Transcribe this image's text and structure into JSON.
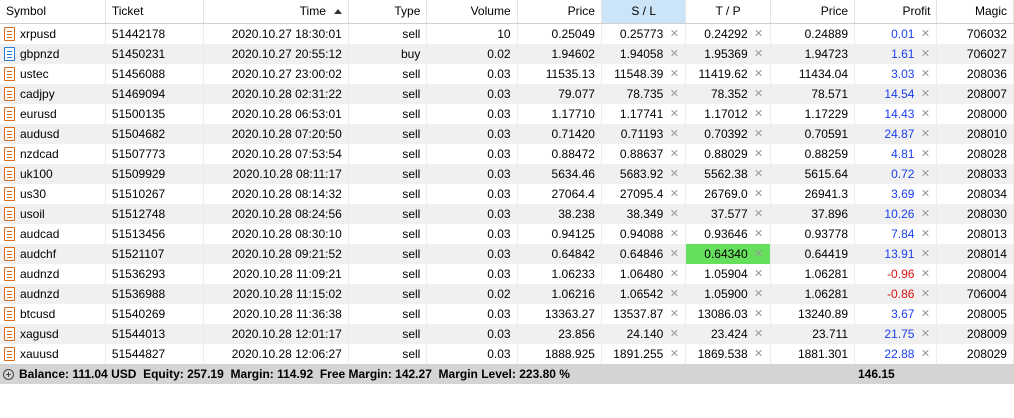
{
  "columns": {
    "symbol": "Symbol",
    "ticket": "Ticket",
    "time": "Time",
    "type": "Type",
    "volume": "Volume",
    "price": "Price",
    "sl": "S / L",
    "tp": "T / P",
    "current_price": "Price",
    "profit": "Profit",
    "magic": "Magic"
  },
  "rows": [
    {
      "symbol": "xrpusd",
      "ticket": "51442178",
      "time": "2020.10.27 18:30:01",
      "type": "sell",
      "volume": "10",
      "price": "0.25049",
      "sl": "0.25773",
      "tp": "0.24292",
      "current": "0.24889",
      "profit": "0.01",
      "magic": "706032",
      "profit_sign": "pos",
      "icon": "sell"
    },
    {
      "symbol": "gbpnzd",
      "ticket": "51450231",
      "time": "2020.10.27 20:55:12",
      "type": "buy",
      "volume": "0.02",
      "price": "1.94602",
      "sl": "1.94058",
      "tp": "1.95369",
      "current": "1.94723",
      "profit": "1.61",
      "magic": "706027",
      "profit_sign": "pos",
      "icon": "buy"
    },
    {
      "symbol": "ustec",
      "ticket": "51456088",
      "time": "2020.10.27 23:00:02",
      "type": "sell",
      "volume": "0.03",
      "price": "11535.13",
      "sl": "11548.39",
      "tp": "11419.62",
      "current": "11434.04",
      "profit": "3.03",
      "magic": "208036",
      "profit_sign": "pos",
      "icon": "sell"
    },
    {
      "symbol": "cadjpy",
      "ticket": "51469094",
      "time": "2020.10.28 02:31:22",
      "type": "sell",
      "volume": "0.03",
      "price": "79.077",
      "sl": "78.735",
      "tp": "78.352",
      "current": "78.571",
      "profit": "14.54",
      "magic": "208007",
      "profit_sign": "pos",
      "icon": "sell"
    },
    {
      "symbol": "eurusd",
      "ticket": "51500135",
      "time": "2020.10.28 06:53:01",
      "type": "sell",
      "volume": "0.03",
      "price": "1.17710",
      "sl": "1.17741",
      "tp": "1.17012",
      "current": "1.17229",
      "profit": "14.43",
      "magic": "208000",
      "profit_sign": "pos",
      "icon": "sell"
    },
    {
      "symbol": "audusd",
      "ticket": "51504682",
      "time": "2020.10.28 07:20:50",
      "type": "sell",
      "volume": "0.03",
      "price": "0.71420",
      "sl": "0.71193",
      "tp": "0.70392",
      "current": "0.70591",
      "profit": "24.87",
      "magic": "208010",
      "profit_sign": "pos",
      "icon": "sell"
    },
    {
      "symbol": "nzdcad",
      "ticket": "51507773",
      "time": "2020.10.28 07:53:54",
      "type": "sell",
      "volume": "0.03",
      "price": "0.88472",
      "sl": "0.88637",
      "tp": "0.88029",
      "current": "0.88259",
      "profit": "4.81",
      "magic": "208028",
      "profit_sign": "pos",
      "icon": "sell"
    },
    {
      "symbol": "uk100",
      "ticket": "51509929",
      "time": "2020.10.28 08:11:17",
      "type": "sell",
      "volume": "0.03",
      "price": "5634.46",
      "sl": "5683.92",
      "tp": "5562.38",
      "current": "5615.64",
      "profit": "0.72",
      "magic": "208033",
      "profit_sign": "pos",
      "icon": "sell"
    },
    {
      "symbol": "us30",
      "ticket": "51510267",
      "time": "2020.10.28 08:14:32",
      "type": "sell",
      "volume": "0.03",
      "price": "27064.4",
      "sl": "27095.4",
      "tp": "26769.0",
      "current": "26941.3",
      "profit": "3.69",
      "magic": "208034",
      "profit_sign": "pos",
      "icon": "sell"
    },
    {
      "symbol": "usoil",
      "ticket": "51512748",
      "time": "2020.10.28 08:24:56",
      "type": "sell",
      "volume": "0.03",
      "price": "38.238",
      "sl": "38.349",
      "tp": "37.577",
      "current": "37.896",
      "profit": "10.26",
      "magic": "208030",
      "profit_sign": "pos",
      "icon": "sell"
    },
    {
      "symbol": "audcad",
      "ticket": "51513456",
      "time": "2020.10.28 08:30:10",
      "type": "sell",
      "volume": "0.03",
      "price": "0.94125",
      "sl": "0.94088",
      "tp": "0.93646",
      "current": "0.93778",
      "profit": "7.84",
      "magic": "208013",
      "profit_sign": "pos",
      "icon": "sell"
    },
    {
      "symbol": "audchf",
      "ticket": "51521107",
      "time": "2020.10.28 09:21:52",
      "type": "sell",
      "volume": "0.03",
      "price": "0.64842",
      "sl": "0.64846",
      "tp": "0.64340",
      "current": "0.64419",
      "profit": "13.91",
      "magic": "208014",
      "profit_sign": "pos",
      "icon": "sell",
      "tp_highlight": true
    },
    {
      "symbol": "audnzd",
      "ticket": "51536293",
      "time": "2020.10.28 11:09:21",
      "type": "sell",
      "volume": "0.03",
      "price": "1.06233",
      "sl": "1.06480",
      "tp": "1.05904",
      "current": "1.06281",
      "profit": "-0.96",
      "magic": "208004",
      "profit_sign": "neg",
      "icon": "sell"
    },
    {
      "symbol": "audnzd",
      "ticket": "51536988",
      "time": "2020.10.28 11:15:02",
      "type": "sell",
      "volume": "0.02",
      "price": "1.06216",
      "sl": "1.06542",
      "tp": "1.05900",
      "current": "1.06281",
      "profit": "-0.86",
      "magic": "706004",
      "profit_sign": "neg",
      "icon": "sell"
    },
    {
      "symbol": "btcusd",
      "ticket": "51540269",
      "time": "2020.10.28 11:36:38",
      "type": "sell",
      "volume": "0.03",
      "price": "13363.27",
      "sl": "13537.87",
      "tp": "13086.03",
      "current": "13240.89",
      "profit": "3.67",
      "magic": "208005",
      "profit_sign": "pos",
      "icon": "sell"
    },
    {
      "symbol": "xagusd",
      "ticket": "51544013",
      "time": "2020.10.28 12:01:17",
      "type": "sell",
      "volume": "0.03",
      "price": "23.856",
      "sl": "24.140",
      "tp": "23.424",
      "current": "23.711",
      "profit": "21.75",
      "magic": "208009",
      "profit_sign": "pos",
      "icon": "sell"
    },
    {
      "symbol": "xauusd",
      "ticket": "51544827",
      "time": "2020.10.28 12:06:27",
      "type": "sell",
      "volume": "0.03",
      "price": "1888.925",
      "sl": "1891.255",
      "tp": "1869.538",
      "current": "1881.301",
      "profit": "22.88",
      "magic": "208029",
      "profit_sign": "pos",
      "icon": "sell"
    }
  ],
  "footer": {
    "summary": "Balance: 111.04 USD  Equity: 257.19  Margin: 114.92  Free Margin: 142.27  Margin Level: 223.80 %",
    "total_profit": "146.15"
  },
  "colors": {
    "profit_pos": "#1a3ef0",
    "profit_neg": "#e01010",
    "tp_highlight": "#66e05c",
    "sl_header": "#cce4f7"
  },
  "icons": {
    "sell": "sell-order-icon",
    "buy": "buy-order-icon",
    "close": "close-icon",
    "sort": "sort-asc-icon",
    "expand": "expand-plus-icon"
  }
}
